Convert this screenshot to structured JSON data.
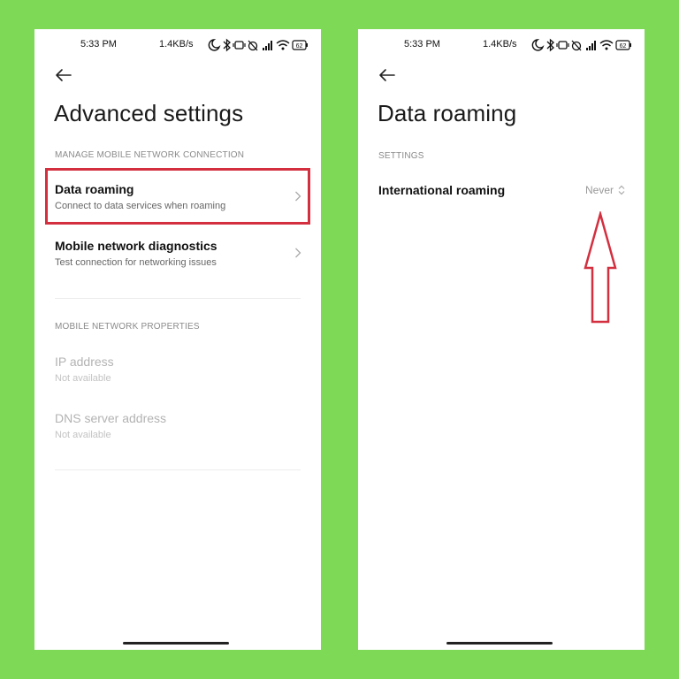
{
  "status_bar": {
    "time": "5:33 PM",
    "speed": "1.4KB/s",
    "battery": "62"
  },
  "screen_left": {
    "title": "Advanced settings",
    "section1_header": "MANAGE MOBILE NETWORK CONNECTION",
    "items": [
      {
        "title": "Data roaming",
        "subtitle": "Connect to data services when roaming"
      },
      {
        "title": "Mobile network diagnostics",
        "subtitle": "Test connection for networking issues"
      }
    ],
    "section2_header": "MOBILE NETWORK PROPERTIES",
    "properties": [
      {
        "title": "IP address",
        "value": "Not available"
      },
      {
        "title": "DNS server address",
        "value": "Not available"
      }
    ]
  },
  "screen_right": {
    "title": "Data roaming",
    "section_header": "SETTINGS",
    "setting": {
      "label": "International roaming",
      "value": "Never"
    }
  },
  "colors": {
    "background": "#7ed957",
    "highlight": "#d32f3f",
    "screen": "#ffffff"
  }
}
